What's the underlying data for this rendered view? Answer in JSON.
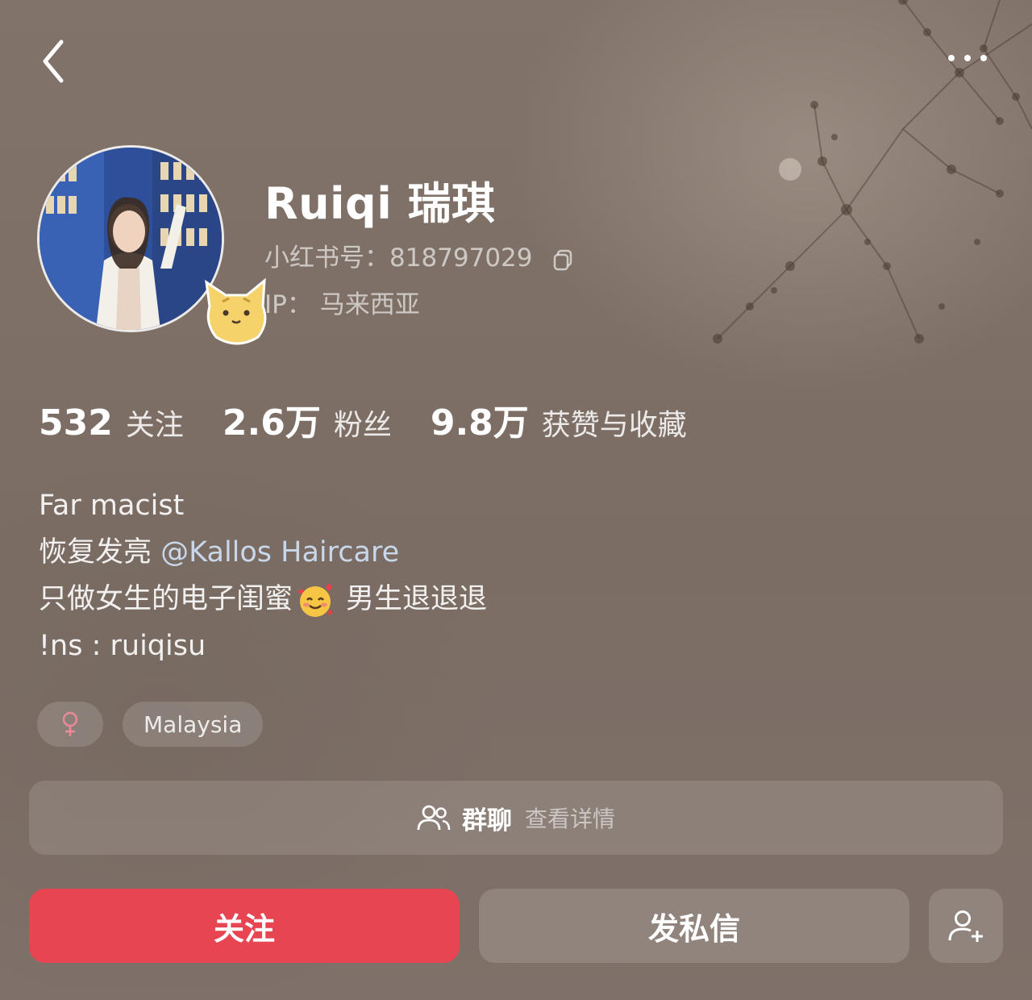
{
  "profile": {
    "name": "Ruiqi 瑞琪",
    "id_text": "小红书号：818797029",
    "ip_text": "IP： 马来西亚"
  },
  "stats": [
    {
      "value": "532",
      "label": "关注"
    },
    {
      "value": "2.6万",
      "label": "粉丝"
    },
    {
      "value": "9.8万",
      "label": "获赞与收藏"
    }
  ],
  "bio": {
    "line1": "Far macist",
    "line2_prefix": "恢复发亮",
    "line2_mention": "@Kallos Haircare",
    "line3_prefix": "只做女生的电子闺蜜",
    "line3_suffix": "男生退退退",
    "line4": "!ns : ruiqisu"
  },
  "tags": {
    "gender_symbol": "♀",
    "location": "Malaysia"
  },
  "group_chat": {
    "title": "群聊",
    "subtitle": "查看详情"
  },
  "actions": {
    "follow_label": "关注",
    "message_label": "发私信"
  },
  "icons": {
    "back": "chevron-left-icon",
    "more": "more-dots-icon",
    "copy": "copy-icon",
    "group": "group-users-icon",
    "add_friend": "add-user-icon",
    "emoji": "smiling-face-with-hearts-icon"
  },
  "colors": {
    "follow_button": "#e84552",
    "mention": "#c9d7ea",
    "gender_female": "#e98a98"
  }
}
